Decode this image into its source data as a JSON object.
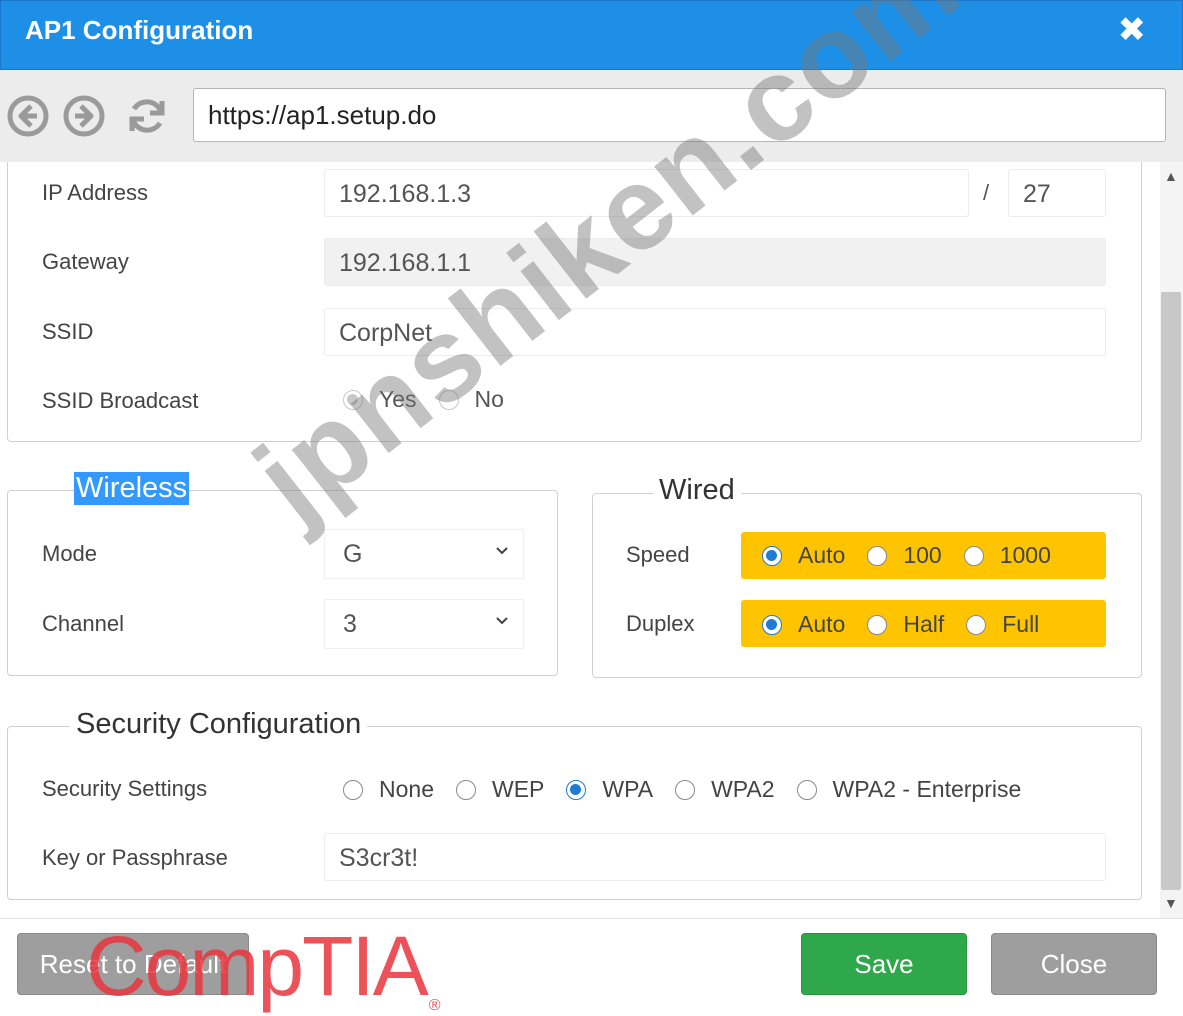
{
  "window": {
    "title": "AP1 Configuration",
    "close_glyph": "✖"
  },
  "browser": {
    "url": "https://ap1.setup.do",
    "icons": [
      "back-icon",
      "forward-icon",
      "refresh-icon"
    ]
  },
  "network": {
    "ip_label": "IP Address",
    "ip_value": "192.168.1.3",
    "prefix_separator": "/",
    "prefix_value": "27",
    "gateway_label": "Gateway",
    "gateway_value": "192.168.1.1",
    "ssid_label": "SSID",
    "ssid_value": "CorpNet",
    "broadcast_label": "SSID Broadcast",
    "broadcast_options": [
      "Yes",
      "No"
    ],
    "broadcast_selected": "Yes"
  },
  "wireless": {
    "legend": "Wireless",
    "mode_label": "Mode",
    "mode_value": "G",
    "channel_label": "Channel",
    "channel_value": "3"
  },
  "wired": {
    "legend": "Wired",
    "speed_label": "Speed",
    "speed_options": [
      "Auto",
      "100",
      "1000"
    ],
    "speed_selected": "Auto",
    "duplex_label": "Duplex",
    "duplex_options": [
      "Auto",
      "Half",
      "Full"
    ],
    "duplex_selected": "Auto",
    "highlight_color": "#ffc400"
  },
  "security": {
    "legend": "Security Configuration",
    "settings_label": "Security Settings",
    "settings_options": [
      "None",
      "WEP",
      "WPA",
      "WPA2",
      "WPA2 - Enterprise"
    ],
    "settings_selected": "WPA",
    "key_label": "Key or Passphrase",
    "key_value": "S3cr3t!"
  },
  "footer": {
    "reset_label": "Reset to Default",
    "save_label": "Save",
    "close_label": "Close",
    "save_color": "#2fa84b"
  },
  "overlay": {
    "watermark": "jpnshiken.com",
    "logo": "CompTIA",
    "logo_mark": "®"
  }
}
